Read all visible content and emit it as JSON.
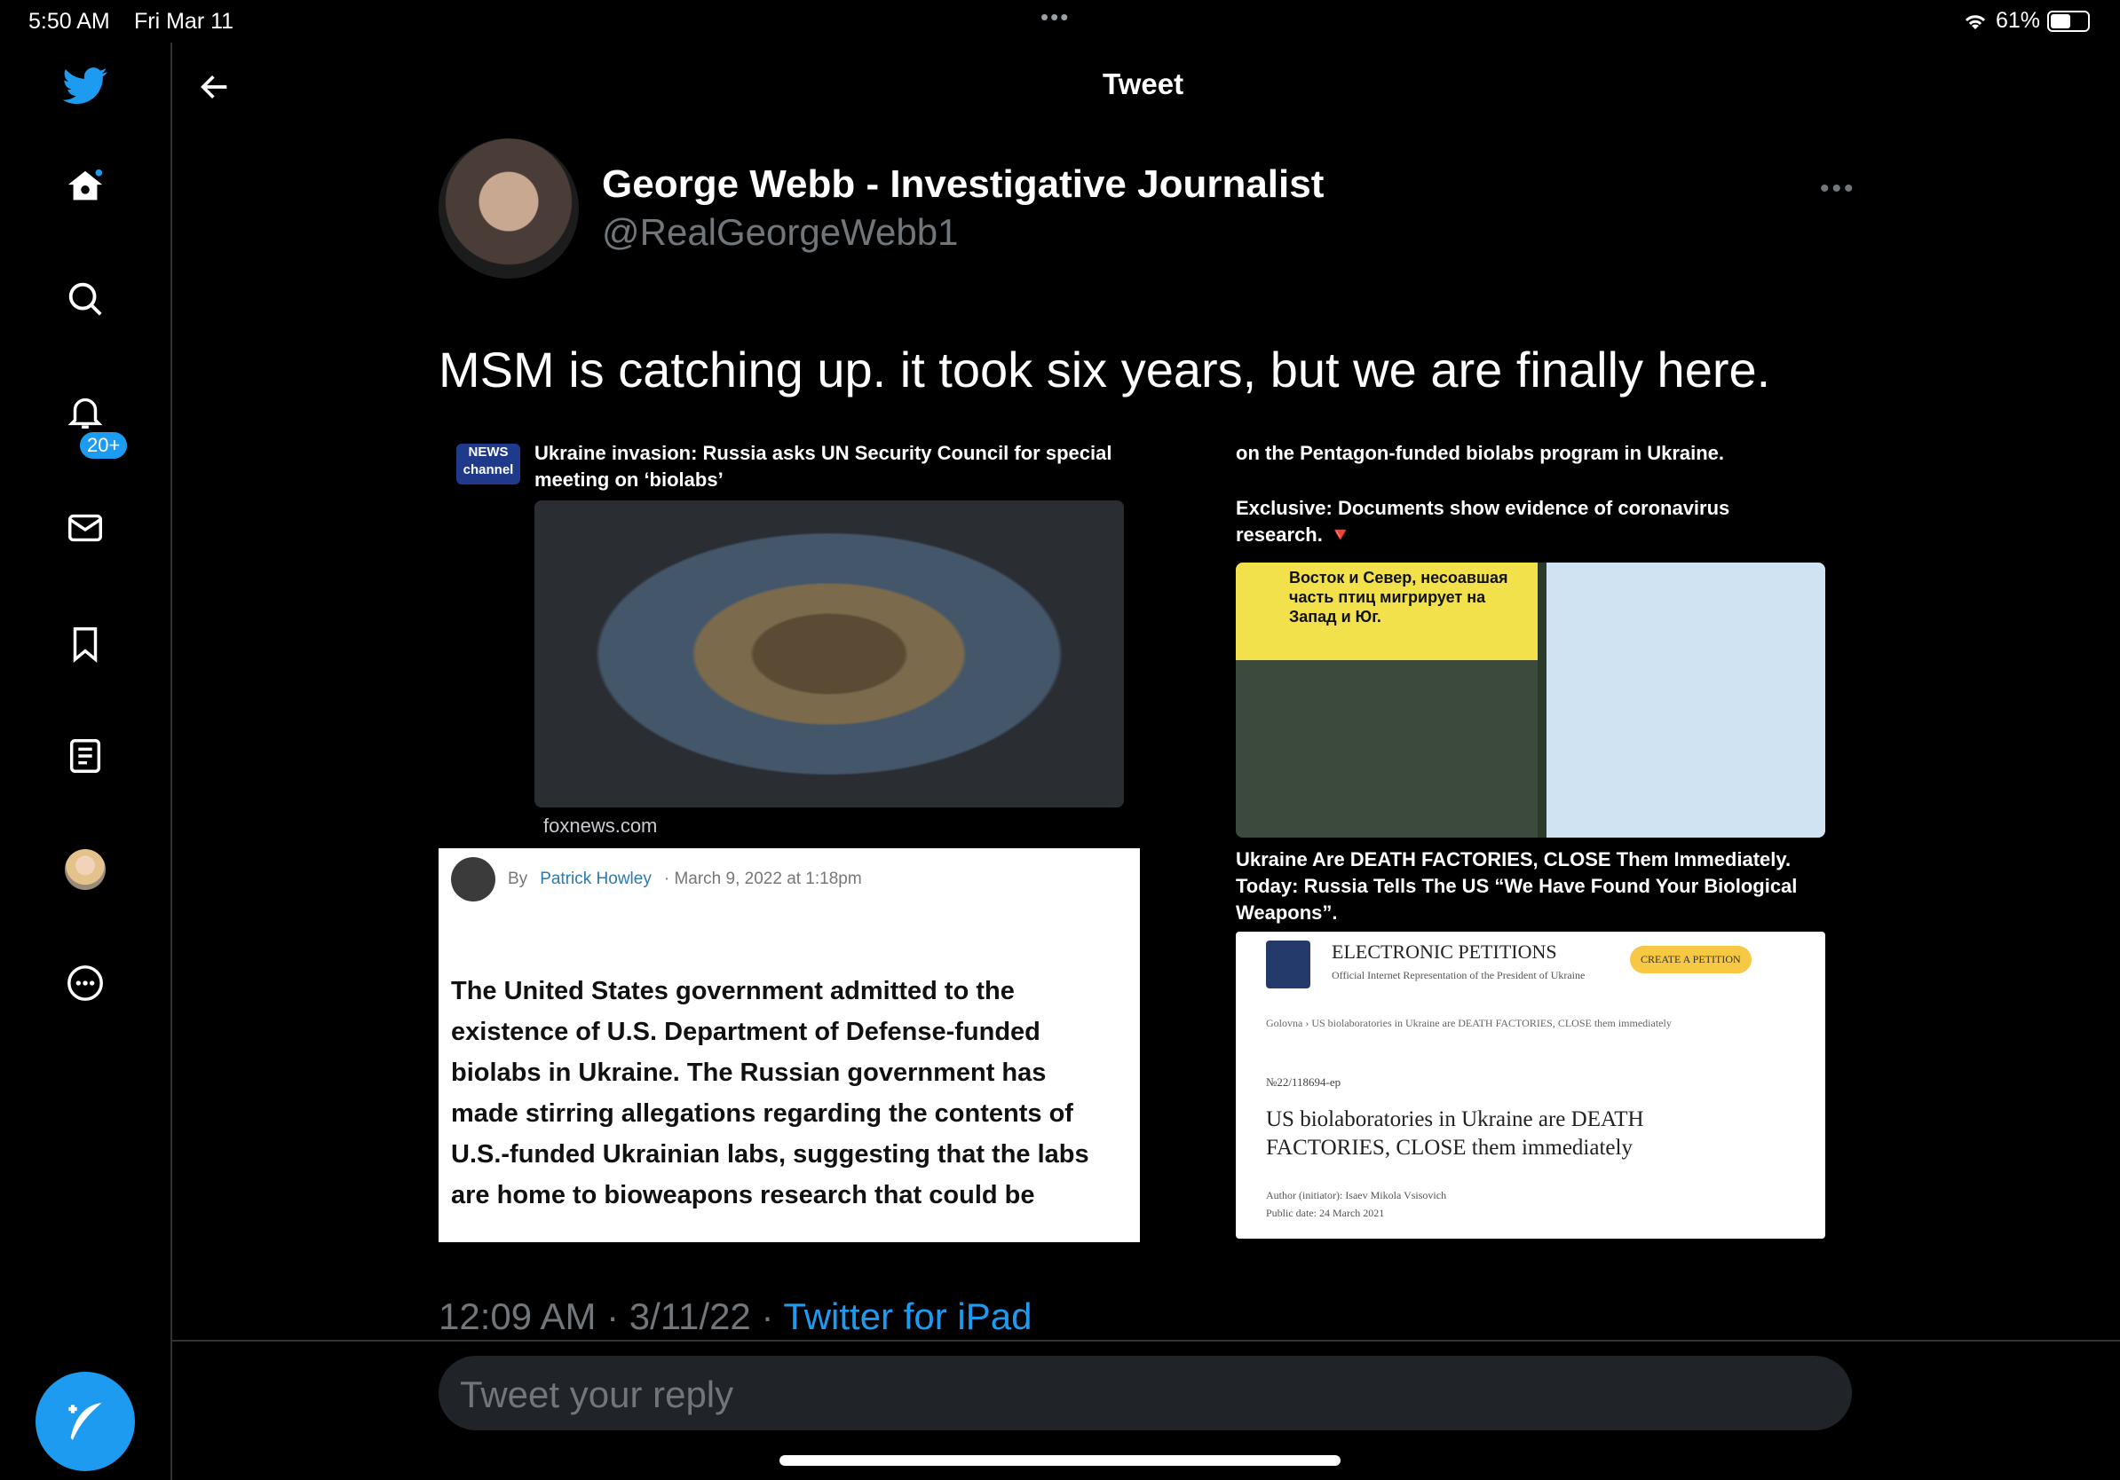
{
  "status_bar": {
    "time": "5:50 AM",
    "date": "Fri Mar 11",
    "battery": "61%",
    "battery_level": 0.61
  },
  "sidebar": {
    "items": [
      {
        "name": "twitter-logo"
      },
      {
        "name": "home"
      },
      {
        "name": "explore"
      },
      {
        "name": "notifications",
        "badge": "20+"
      },
      {
        "name": "messages"
      },
      {
        "name": "bookmarks"
      },
      {
        "name": "lists"
      },
      {
        "name": "profile"
      },
      {
        "name": "more"
      }
    ],
    "compose_icon": "compose-tweet-icon"
  },
  "header": {
    "title": "Tweet"
  },
  "tweet": {
    "author_name": "George Webb - Investigative Journalist",
    "handle": "@RealGeorgeWebb1",
    "text": "MSM is catching up. it took six years, but we are finally here.",
    "timestamp": "12:09 AM · 3/11/22 · ",
    "client": "Twitter for iPad"
  },
  "media": {
    "q1": {
      "logo": "NEWS channel",
      "headline": "Ukraine invasion: Russia asks UN Security Council for special meeting on ‘biolabs’",
      "source": "foxnews.com"
    },
    "q2": {
      "line1": "on the Pentagon-funded biolabs program in Ukraine.",
      "line2": "Exclusive: Documents show evidence of coronavirus research. 🔻",
      "image_caption": "Восток и Север, несоавшая часть птиц мигрирует на Запад и Юг."
    },
    "q3": {
      "by": "By",
      "author": "Patrick Howley",
      "date": "· March 9, 2022 at 1:18pm",
      "article": "The United States government admitted to the existence of U.S. Department of Defense-funded biolabs in Ukraine. The Russian government has made stirring allegations regarding the contents of U.S.-funded Ukrainian labs, suggesting that the labs are home to bioweapons research that could be"
    },
    "q4": {
      "text": "Ukraine Are DEATH FACTORIES, CLOSE Them Immediately. Today: Russia Tells The US “We Have Found Your Biological Weapons”.",
      "petition_title": "ELECTRONIC PETITIONS",
      "petition_sub": "Official Internet Representation of the President of Ukraine",
      "petition_button": "CREATE A PETITION",
      "breadcrumb": "Golovna › US biolaboratories in Ukraine are DEATH FACTORIES, CLOSE them immediately",
      "number": "№22/118694-ep",
      "heading": "US biolaboratories in Ukraine are DEATH FACTORIES, CLOSE them immediately",
      "author_line": "Author (initiator): Isaev Mikola Vsisovich",
      "date_line": "Public date: 24 March 2021"
    }
  },
  "reply": {
    "placeholder": "Tweet your reply"
  }
}
